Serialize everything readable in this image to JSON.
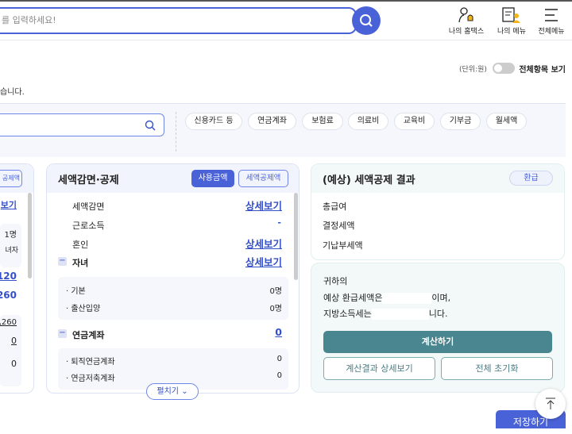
{
  "header": {
    "search_placeholder": "를 입력하세요!",
    "icons": [
      {
        "name": "my-hometax",
        "label": "나의 홈택스"
      },
      {
        "name": "my-menu",
        "label": "나의 메뉴"
      },
      {
        "name": "all-menu",
        "label": "전체메뉴"
      }
    ]
  },
  "top": {
    "unit": "(단위:원)",
    "toggle_label": "전체항목 보기",
    "toggle_on": false,
    "notice": "습니다."
  },
  "chips": [
    "신용카드 등",
    "연금계좌",
    "보험료",
    "의료비",
    "교육비",
    "기부금",
    "월세액"
  ],
  "left_card": {
    "button": "공제액",
    "link": "보기",
    "rows": [
      "1명",
      "녀자"
    ],
    "amounts": [
      "120",
      "260"
    ],
    "sub": [
      ",260",
      "0",
      "0"
    ]
  },
  "mid_card": {
    "title": "세액감면·공제",
    "btn_used": "사용금액",
    "btn_deduct": "세액공제액",
    "rows": [
      {
        "label": "세액감면",
        "value": "상세보기"
      },
      {
        "label": "근로소득",
        "value": "-"
      },
      {
        "label": "혼인",
        "value": "상세보기"
      },
      {
        "label": "자녀",
        "value": "상세보기"
      }
    ],
    "child_sub": [
      {
        "label": "기본",
        "value": "0명"
      },
      {
        "label": "출산입양",
        "value": "0명"
      }
    ],
    "pension": {
      "label": "연금계좌",
      "value": "0"
    },
    "pension_sub": [
      {
        "label": "퇴직연금계좌",
        "value": "0"
      },
      {
        "label": "연금저축계좌",
        "value": "0"
      }
    ],
    "expand": "펼치기"
  },
  "result_card": {
    "title": "(예상) 세액공제 결과",
    "badge": "환급",
    "rows": [
      "총급여",
      "결정세액",
      "기납부세액"
    ],
    "msg1": "귀하의",
    "msg2a": "예상 환급세액은",
    "msg2b": "이며,",
    "msg3a": "지방소득세는",
    "msg3b": "니다.",
    "calc": "계산하기",
    "detail": "계산결과 상세보기",
    "reset": "전체 초기화"
  },
  "save": "저장하기"
}
